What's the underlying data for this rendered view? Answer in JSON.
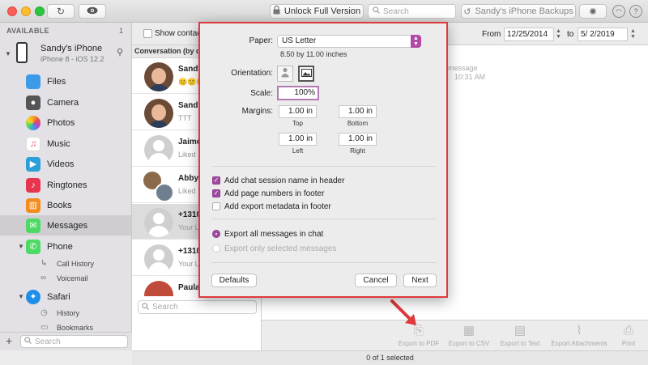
{
  "toolbar": {
    "unlock_label": "Unlock Full Version",
    "search_placeholder": "Search",
    "backups_label": "Sandy's iPhone Backups"
  },
  "sidebar": {
    "section_title": "AVAILABLE",
    "section_count": "1",
    "device_name": "Sandy's iPhone",
    "device_model": "iPhone 8 - iOS 12.2",
    "items": [
      {
        "label": "Files",
        "icon": "folder-icon"
      },
      {
        "label": "Camera",
        "icon": "camera-icon"
      },
      {
        "label": "Photos",
        "icon": "photos-icon"
      },
      {
        "label": "Music",
        "icon": "music-icon"
      },
      {
        "label": "Videos",
        "icon": "videos-icon"
      },
      {
        "label": "Ringtones",
        "icon": "ringtones-icon"
      },
      {
        "label": "Books",
        "icon": "books-icon"
      },
      {
        "label": "Messages",
        "icon": "messages-icon"
      },
      {
        "label": "Phone",
        "icon": "phone-icon"
      },
      {
        "label": "Safari",
        "icon": "safari-icon"
      }
    ],
    "phone_children": [
      "Call History",
      "Voicemail"
    ],
    "safari_children": [
      "History",
      "Bookmarks"
    ],
    "search_placeholder": "Search",
    "selected_item": "Messages"
  },
  "conversations": {
    "show_contacts_label": "Show contacts",
    "header_label": "Conversation (by date)",
    "rows": [
      {
        "name": "Sandy",
        "preview": "😊🙂🙂"
      },
      {
        "name": "Sandy",
        "preview": "TTT"
      },
      {
        "name": "Jaime",
        "preview": "Liked"
      },
      {
        "name": "Abby",
        "preview": "Liked"
      },
      {
        "name": "+1310",
        "preview": "Your L"
      },
      {
        "name": "+1310",
        "preview": "Your L"
      },
      {
        "name": "Paula",
        "preview": ""
      }
    ],
    "selected_index": 4,
    "search_placeholder": "Search"
  },
  "filter": {
    "from_label": "From",
    "from_date": "12/25/2014",
    "to_label": "to",
    "to_date": "5/ 2/2019"
  },
  "message_preview": {
    "line1": "message",
    "line2": "10:31 AM"
  },
  "dialog": {
    "paper_label": "Paper:",
    "paper_value": "US Letter",
    "paper_size": "8.50 by 11.00 inches",
    "orientation_label": "Orientation:",
    "scale_label": "Scale:",
    "scale_value": "100%",
    "margins_label": "Margins:",
    "margin_top": "1.00 in",
    "margin_bottom": "1.00 in",
    "margin_left": "1.00 in",
    "margin_right": "1.00 in",
    "caption_top": "Top",
    "caption_bottom": "Bottom",
    "caption_left": "Left",
    "caption_right": "Right",
    "cb_session_name": "Add chat session name in header",
    "cb_page_numbers": "Add page numbers in footer",
    "cb_export_metadata": "Add export metadata in footer",
    "radio_all": "Export all messages in chat",
    "radio_selected": "Export only selected messages",
    "defaults_label": "Defaults",
    "cancel_label": "Cancel",
    "next_label": "Next"
  },
  "export_bar": {
    "pdf": "Export to PDF",
    "csv": "Export to CSV",
    "text": "Export to Text",
    "attachments": "Export Attachments",
    "print": "Print"
  },
  "status": {
    "text": "0 of 1 selected"
  },
  "colors": {
    "accent": "#a04aa0",
    "highlight_border": "#e0393c"
  }
}
